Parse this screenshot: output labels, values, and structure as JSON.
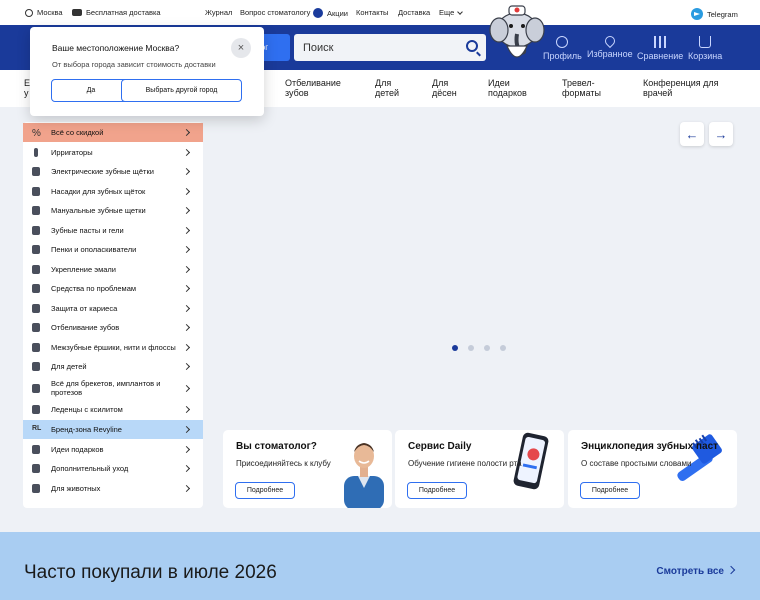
{
  "topbar": {
    "city": "Москва",
    "delivery": "Бесплатная доставка",
    "links": [
      "Журнал",
      "Вопрос стоматологу",
      "Акции",
      "Контакты",
      "Доставка",
      "Еще"
    ],
    "telegram": "Telegram"
  },
  "header": {
    "catalog_label": "лог",
    "search_placeholder": "Поиск",
    "actions": [
      "Профиль",
      "Избранное",
      "Сравнение",
      "Корзина"
    ]
  },
  "catnav": {
    "partial": [
      "Е",
      "у"
    ],
    "items": [
      [
        "Отбеливание",
        "зубов"
      ],
      [
        "Для",
        "детей"
      ],
      [
        "Для",
        "дёсен"
      ],
      [
        "Идеи",
        "подарков"
      ],
      [
        "Тревел-",
        "форматы"
      ],
      [
        "Конференция для",
        "врачей"
      ]
    ]
  },
  "sidebar": {
    "items": [
      "Всё со скидкой",
      "Ирригаторы",
      "Электрические зубные щётки",
      "Насадки для зубных щёток",
      "Мануальные зубные щетки",
      "Зубные пасты и гели",
      "Пенки и ополаскиватели",
      "Укрепление эмали",
      "Средства по проблемам",
      "Защита от кариеса",
      "Отбеливание зубов",
      "Межзубные ёршики, нити и флоссы",
      "Для детей",
      "Всё для брекетов, имплантов и протезов",
      "Леденцы с ксилитом",
      "Бренд-зона Revyline",
      "Идеи подарков",
      "Дополнительный уход",
      "Для животных"
    ],
    "discount_icon": "%",
    "brand_icon": "RL"
  },
  "slider": {
    "prev": "←",
    "next": "→",
    "slides": 4,
    "active": 0
  },
  "cards": [
    {
      "title": "Вы стоматолог?",
      "subtitle": "Присоединяйтесь к клубу",
      "button": "Подробнее"
    },
    {
      "title": "Сервис Daily",
      "subtitle": "Обучение гигиене полости рта",
      "button": "Подробнее"
    },
    {
      "title": "Энциклопедия зубных паст",
      "subtitle": "О составе простыми словами",
      "button": "Подробнее"
    }
  ],
  "band": {
    "title": "Часто покупали в июле 2026",
    "link": "Смотреть все"
  },
  "popup": {
    "question": "Ваше местоположение Москва?",
    "note": "От выбора города зависит стоимость доставки",
    "yes": "Да",
    "other": "Выбрать другой город",
    "close": "×"
  },
  "colors": {
    "header": "#1a3a9a",
    "accent": "#2f6ff0",
    "discount": "#f1a38c",
    "brand": "#b8d8f8",
    "band": "#a9cdf2"
  }
}
